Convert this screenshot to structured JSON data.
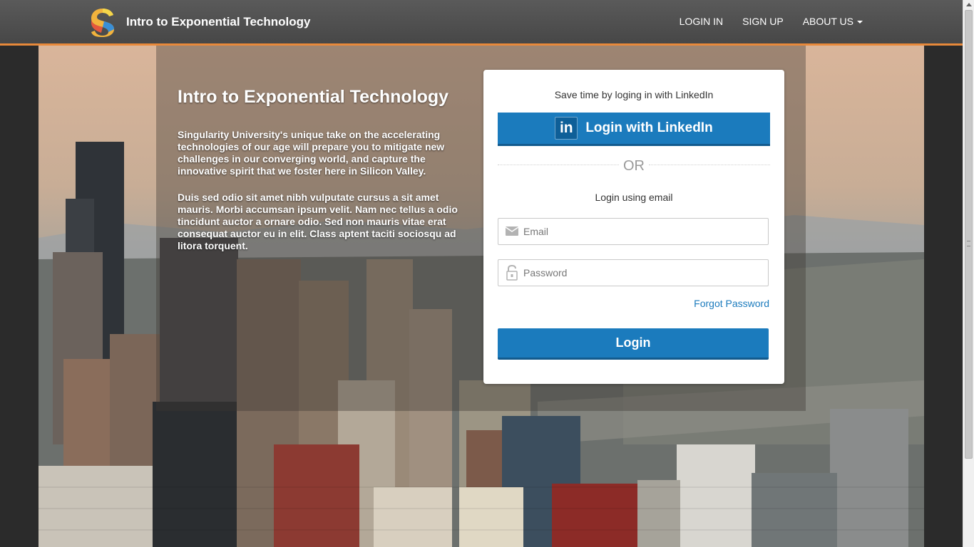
{
  "navbar": {
    "brand_title": "Intro to Exponential Technology",
    "logo_icon": "singularity-s-logo-icon",
    "links": [
      {
        "label": "LOGIN IN"
      },
      {
        "label": "SIGN UP"
      },
      {
        "label": "ABOUT US",
        "has_dropdown": true
      }
    ],
    "accent_color": "#e8893a"
  },
  "intro": {
    "title": "Intro to Exponential Technology",
    "paragraphs": [
      "Singularity University's unique take on the accelerating technologies of our age will prepare you to mitigate new challenges in our converging world, and capture the innovative spirit that we foster here in Silicon Valley.",
      "Duis sed odio sit amet nibh vulputate cursus a sit amet mauris. Morbi accumsan ipsum velit. Nam nec tellus a odio tincidunt auctor a ornare odio. Sed non mauris vitae erat consequat auctor eu in elit. Class aptent taciti sociosqu ad litora torquent."
    ]
  },
  "login_card": {
    "save_time_text": "Save time by loging in with LinkedIn",
    "linkedin_icon_text": "in",
    "linkedin_button_label": "Login with LinkedIn",
    "or_text": "OR",
    "email_heading": "Login using email",
    "email_placeholder": "Email",
    "password_placeholder": "Password",
    "forgot_password_label": "Forgot Password",
    "login_button_label": "Login",
    "button_color": "#1b7bbd"
  }
}
